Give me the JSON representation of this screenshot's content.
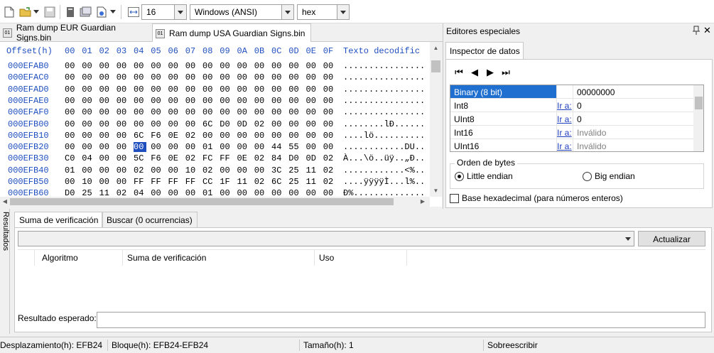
{
  "toolbar": {
    "bytes_per_row": "16",
    "encoding": "Windows (ANSI)",
    "display_mode": "hex"
  },
  "tabs": [
    {
      "label": "Ram dump EUR Guardian Signs.bin",
      "icon": "document-icon",
      "active": false
    },
    {
      "label": "Ram dump USA Guardian Signs.bin",
      "icon": "document-icon",
      "active": true
    }
  ],
  "hex": {
    "header": {
      "offset_label": "Offset(h)",
      "columns": [
        "00",
        "01",
        "02",
        "03",
        "04",
        "05",
        "06",
        "07",
        "08",
        "09",
        "0A",
        "0B",
        "0C",
        "0D",
        "0E",
        "0F"
      ],
      "text_label": "Texto decodific"
    },
    "rows": [
      {
        "offset": "000EFAB0",
        "bytes": [
          "00",
          "00",
          "00",
          "00",
          "00",
          "00",
          "00",
          "00",
          "00",
          "00",
          "00",
          "00",
          "00",
          "00",
          "00",
          "00"
        ],
        "text": "................"
      },
      {
        "offset": "000EFAC0",
        "bytes": [
          "00",
          "00",
          "00",
          "00",
          "00",
          "00",
          "00",
          "00",
          "00",
          "00",
          "00",
          "00",
          "00",
          "00",
          "00",
          "00"
        ],
        "text": "................"
      },
      {
        "offset": "000EFAD0",
        "bytes": [
          "00",
          "00",
          "00",
          "00",
          "00",
          "00",
          "00",
          "00",
          "00",
          "00",
          "00",
          "00",
          "00",
          "00",
          "00",
          "00"
        ],
        "text": "................"
      },
      {
        "offset": "000EFAE0",
        "bytes": [
          "00",
          "00",
          "00",
          "00",
          "00",
          "00",
          "00",
          "00",
          "00",
          "00",
          "00",
          "00",
          "00",
          "00",
          "00",
          "00"
        ],
        "text": "................"
      },
      {
        "offset": "000EFAF0",
        "bytes": [
          "00",
          "00",
          "00",
          "00",
          "00",
          "00",
          "00",
          "00",
          "00",
          "00",
          "00",
          "00",
          "00",
          "00",
          "00",
          "00"
        ],
        "text": "................"
      },
      {
        "offset": "000EFB00",
        "bytes": [
          "00",
          "00",
          "00",
          "00",
          "00",
          "00",
          "00",
          "00",
          "6C",
          "D0",
          "0D",
          "02",
          "00",
          "00",
          "00",
          "00"
        ],
        "text": "........lÐ......"
      },
      {
        "offset": "000EFB10",
        "bytes": [
          "00",
          "00",
          "00",
          "00",
          "6C",
          "F6",
          "0E",
          "02",
          "00",
          "00",
          "00",
          "00",
          "00",
          "00",
          "00",
          "00"
        ],
        "text": "....lö.........."
      },
      {
        "offset": "000EFB20",
        "bytes": [
          "00",
          "00",
          "00",
          "00",
          "00",
          "00",
          "00",
          "00",
          "01",
          "00",
          "00",
          "00",
          "44",
          "55",
          "00",
          "00"
        ],
        "text": "............DU..",
        "selected_index": 4
      },
      {
        "offset": "000EFB30",
        "bytes": [
          "C0",
          "04",
          "00",
          "00",
          "5C",
          "F6",
          "0E",
          "02",
          "FC",
          "FF",
          "0E",
          "02",
          "84",
          "D0",
          "0D",
          "02"
        ],
        "text": "À...\\ö..üÿ..„Ð.."
      },
      {
        "offset": "000EFB40",
        "bytes": [
          "01",
          "00",
          "00",
          "00",
          "02",
          "00",
          "00",
          "10",
          "02",
          "00",
          "00",
          "00",
          "3C",
          "25",
          "11",
          "02"
        ],
        "text": "............<%.."
      },
      {
        "offset": "000EFB50",
        "bytes": [
          "00",
          "10",
          "00",
          "00",
          "FF",
          "FF",
          "FF",
          "FF",
          "CC",
          "1F",
          "11",
          "02",
          "6C",
          "25",
          "11",
          "02"
        ],
        "text": "....ÿÿÿÿÌ...l%.."
      },
      {
        "offset": "000EFB60",
        "bytes": [
          "D0",
          "25",
          "11",
          "02",
          "04",
          "00",
          "00",
          "00",
          "01",
          "00",
          "00",
          "00",
          "00",
          "00",
          "00",
          "00"
        ],
        "text": "Ð%.............."
      }
    ]
  },
  "right_panel": {
    "title": "Editores especiales",
    "tab": "Inspector de datos",
    "rows": [
      {
        "type": "Binary (8 bit)",
        "goto": "",
        "value": "00000000",
        "selected": true,
        "dim": false
      },
      {
        "type": "Int8",
        "goto": "Ir a:",
        "value": "0",
        "selected": false,
        "dim": false
      },
      {
        "type": "UInt8",
        "goto": "Ir a:",
        "value": "0",
        "selected": false,
        "dim": false
      },
      {
        "type": "Int16",
        "goto": "Ir a:",
        "value": "Inválido",
        "selected": false,
        "dim": true
      },
      {
        "type": "UInt16",
        "goto": "Ir a:",
        "value": "Inválido",
        "selected": false,
        "dim": true
      }
    ],
    "byte_order_label": "Orden de bytes",
    "little_endian": "Little endian",
    "big_endian": "Big endian",
    "hex_base_label": "Base hexadecimal (para números enteros)"
  },
  "results": {
    "side_label": "Resultados",
    "tabs": [
      "Suma de verificación",
      "Buscar (0 ocurrencias)"
    ],
    "update_button": "Actualizar",
    "columns": [
      "Algoritmo",
      "Suma de verificación",
      "Uso"
    ],
    "expected_label": "Resultado esperado:"
  },
  "status": {
    "offset": "Desplazamiento(h): EFB24",
    "block": "Bloque(h): EFB24-EFB24",
    "size": "Tamaño(h): 1",
    "mode": "Sobreescribir"
  }
}
